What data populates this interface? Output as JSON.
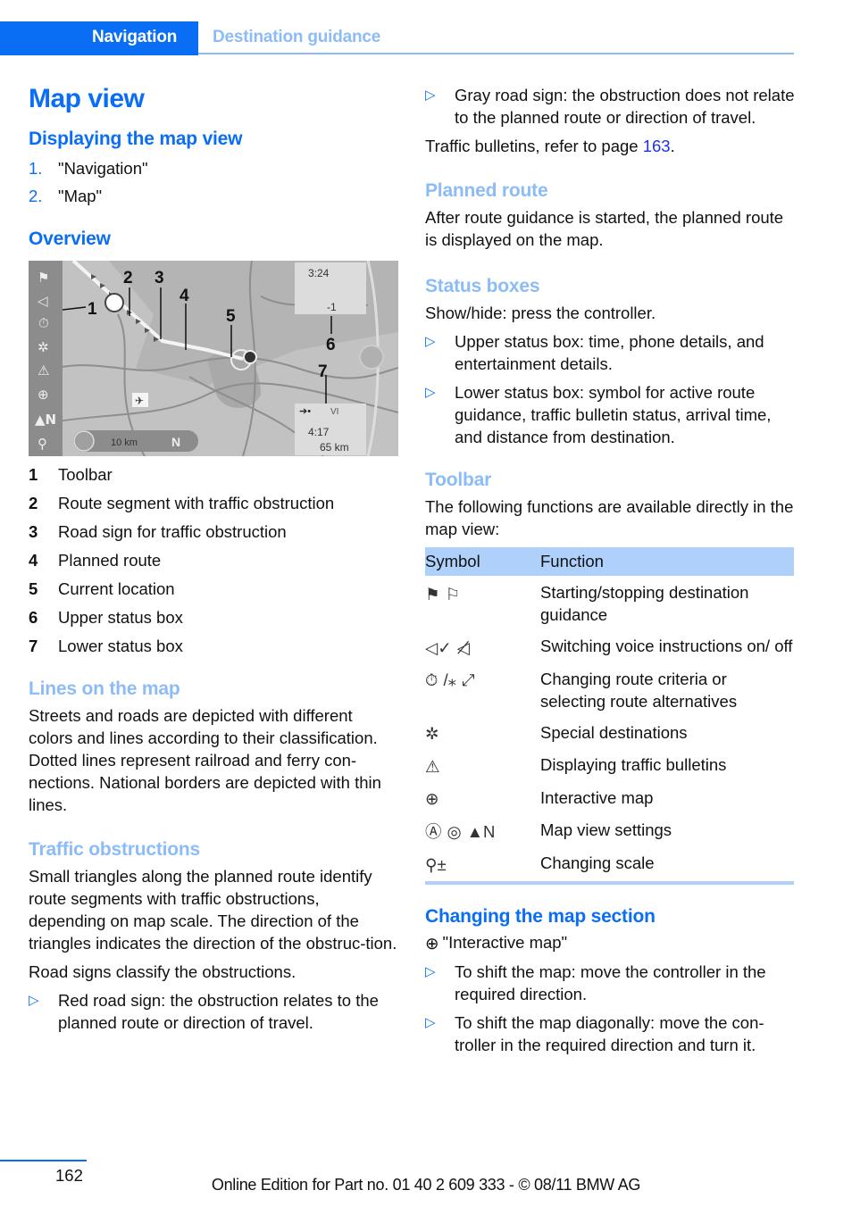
{
  "header": {
    "section": "Navigation",
    "subsection": "Destination guidance"
  },
  "colors": {
    "brand_blue": "#0a6ef5",
    "light_blue": "#8cbcf8",
    "table_header": "#aed0fb",
    "link": "#1a32e6"
  },
  "title": "Map view",
  "displaying": {
    "heading": "Displaying the map view",
    "steps": [
      {
        "num": "1.",
        "text": "\"Navigation\""
      },
      {
        "num": "2.",
        "text": "\"Map\""
      }
    ]
  },
  "overview": {
    "heading": "Overview",
    "figure": {
      "callouts": [
        "1",
        "2",
        "3",
        "4",
        "5",
        "6",
        "7"
      ],
      "upper_status": {
        "time": "3:24",
        "traffic_count": "-1"
      },
      "lower_status": {
        "arrival": "4:17",
        "distance": "65 km",
        "label": "VI"
      },
      "scale": "10 km",
      "north": "N",
      "toolbar_icons": [
        "flag-icon",
        "voice-icon",
        "timer-icon",
        "special-dest-icon",
        "warning-icon",
        "interactive-map-icon",
        "north-icon",
        "zoom-icon"
      ]
    },
    "legend": [
      {
        "num": "1",
        "text": "Toolbar"
      },
      {
        "num": "2",
        "text": "Route segment with traffic obstruction"
      },
      {
        "num": "3",
        "text": "Road sign for traffic obstruction"
      },
      {
        "num": "4",
        "text": "Planned route"
      },
      {
        "num": "5",
        "text": "Current location"
      },
      {
        "num": "6",
        "text": "Upper status box"
      },
      {
        "num": "7",
        "text": "Lower status box"
      }
    ]
  },
  "lines": {
    "heading": "Lines on the map",
    "body": "Streets and roads are depicted with different colors and lines according to their classification. Dotted lines represent railroad and ferry con-nections. National borders are depicted with thin lines."
  },
  "traffic": {
    "heading": "Traffic obstructions",
    "body": "Small triangles along the planned route identify route segments with traffic obstructions, depending on map scale. The direction of the triangles indicates the direction of the obstruc-tion.",
    "signs_intro": "Road signs classify the obstructions.",
    "bullets": [
      "Red road sign: the obstruction relates to the planned route or direction of travel.",
      "Gray road sign: the obstruction does not relate to the planned route or direction of travel."
    ],
    "ref_text": "Traffic bulletins, refer to page ",
    "ref_page": "163",
    "ref_end": "."
  },
  "planned": {
    "heading": "Planned route",
    "body": "After route guidance is started, the planned route is displayed on the map."
  },
  "status": {
    "heading": "Status boxes",
    "intro": "Show/hide: press the controller.",
    "bullets": [
      "Upper status box: time, phone details, and entertainment details.",
      "Lower status box: symbol for active route guidance, traffic bulletin status, arrival time, and distance from destination."
    ]
  },
  "toolbar": {
    "heading": "Toolbar",
    "intro": "The following functions are available directly in the map view:",
    "columns": [
      "Symbol",
      "Function"
    ],
    "rows": [
      {
        "icons": [
          "start-guidance-icon",
          "stop-guidance-icon"
        ],
        "function": "Starting/stopping destination guidance"
      },
      {
        "icons": [
          "voice-on-icon",
          "voice-off-icon"
        ],
        "function": "Switching voice instructions on/ off"
      },
      {
        "icons": [
          "route-criteria-icon",
          "route-alternatives-icon",
          "route-alt-2-icon"
        ],
        "function": "Changing route criteria or selecting route alternatives"
      },
      {
        "icons": [
          "special-destinations-icon"
        ],
        "function": "Special destinations"
      },
      {
        "icons": [
          "traffic-bulletin-icon"
        ],
        "function": "Displaying traffic bulletins"
      },
      {
        "icons": [
          "interactive-map-icon"
        ],
        "function": "Interactive map"
      },
      {
        "icons": [
          "direction-of-travel-icon",
          "perspective-icon",
          "north-up-icon"
        ],
        "function": "Map view settings"
      },
      {
        "icons": [
          "scale-icon"
        ],
        "function": "Changing scale"
      }
    ]
  },
  "changing": {
    "heading": "Changing the map section",
    "menu": "\"Interactive map\"",
    "bullets": [
      "To shift the map: move the controller in the required direction.",
      "To shift the map diagonally: move the con-troller in the required direction and turn it."
    ]
  },
  "footer": {
    "page": "162",
    "edition": "Online Edition for Part no. 01 40 2 609 333 - © 08/11 BMW AG"
  }
}
